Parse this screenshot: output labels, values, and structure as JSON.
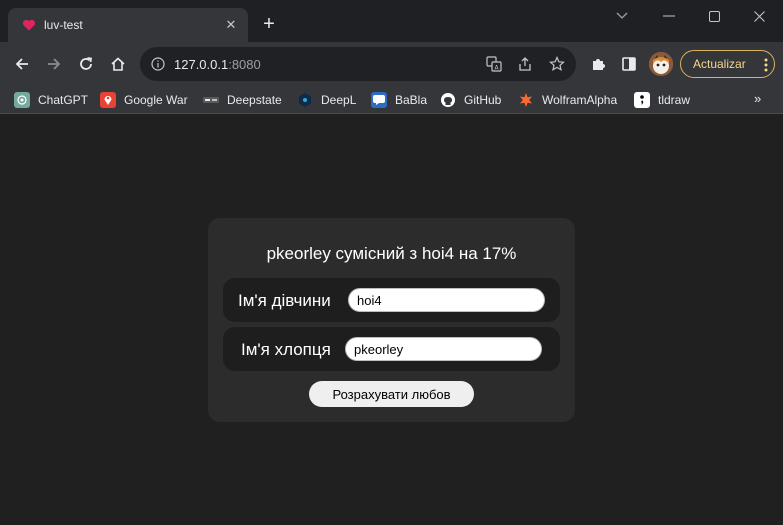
{
  "browser": {
    "tab": {
      "title": "luv-test"
    },
    "address": {
      "host": "127.0.0.1",
      "port": ":8080"
    },
    "update_button": {
      "label": "Actualizar",
      "color": "#d9b25c"
    },
    "bookmarks": [
      {
        "label": "ChatGPT",
        "icon": "chatgpt-icon",
        "color": "#74aa9c"
      },
      {
        "label": "Google War",
        "icon": "map-pin-icon",
        "color": "#ea4335"
      },
      {
        "label": "Deepstate",
        "icon": "deepstate-icon",
        "color": "#444444"
      },
      {
        "label": "DeepL",
        "icon": "deepl-icon",
        "color": "#0f2b46"
      },
      {
        "label": "BaBla",
        "icon": "babla-icon",
        "color": "#2a6dc2"
      },
      {
        "label": "GitHub",
        "icon": "github-icon",
        "color": "#ffffff"
      },
      {
        "label": "WolframAlpha",
        "icon": "wolfram-icon",
        "color": "#f96932"
      },
      {
        "label": "tldraw",
        "icon": "tldraw-icon",
        "color": "#ffffff"
      }
    ]
  },
  "app": {
    "result_text": "pkeorley сумісний з hoi4 на 17%",
    "girl_field": {
      "label": "Ім'я дівчини",
      "value": "hoi4"
    },
    "boy_field": {
      "label": "Ім'я хлопця",
      "value": "pkeorley"
    },
    "calculate_button": {
      "label": "Розрахувати любов"
    }
  }
}
